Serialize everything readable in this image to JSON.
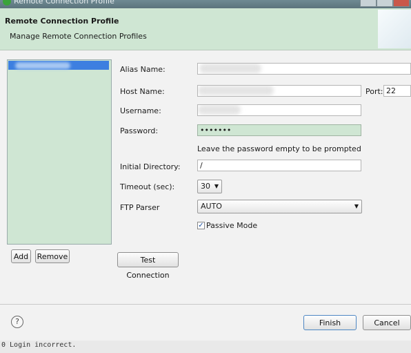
{
  "window": {
    "title": "Remote Connection Profile"
  },
  "header": {
    "title": "Remote Connection Profile",
    "subtitle": "Manage Remote Connection Profiles"
  },
  "list": {
    "add_label": "Add",
    "remove_label": "Remove"
  },
  "form": {
    "alias_label": "Alias Name:",
    "host_label": "Host Name:",
    "port_label": "Port:",
    "port_value": "22",
    "username_label": "Username:",
    "password_label": "Password:",
    "password_value": "•••••••",
    "password_hint": "Leave the password empty to be prompted",
    "initial_dir_label": "Initial Directory:",
    "initial_dir_value": "/",
    "timeout_label": "Timeout (sec):",
    "timeout_value": "30",
    "ftp_parser_label": "FTP Parser",
    "ftp_parser_value": "AUTO",
    "passive_label": "Passive Mode",
    "passive_checked": true,
    "test_connection_label": "Test Connection"
  },
  "footer": {
    "help": "?",
    "finish_label": "Finish",
    "cancel_label": "Cancel"
  },
  "console": {
    "text": "0 Login incorrect."
  }
}
